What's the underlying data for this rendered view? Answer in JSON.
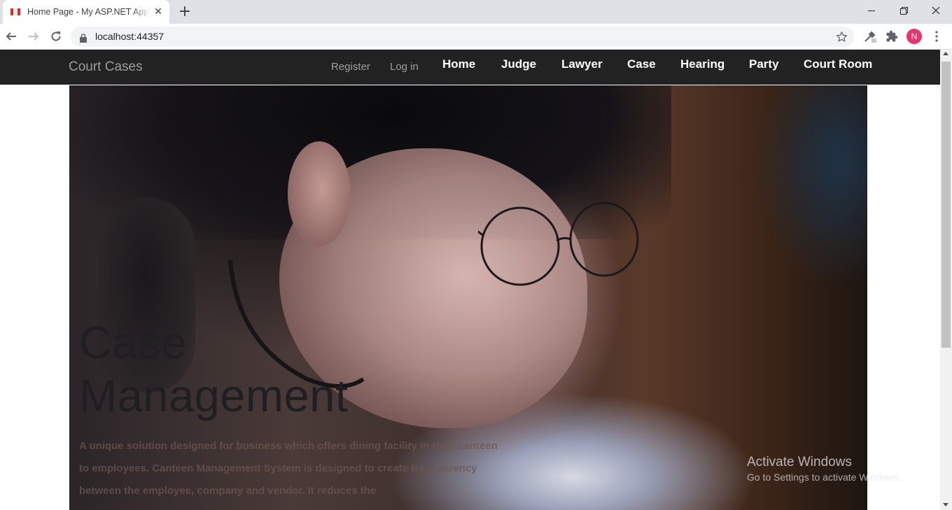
{
  "browser": {
    "tab_title": "Home Page - My ASP.NET Application",
    "tab_close": "✕",
    "new_tab": "+",
    "url": "localhost:44357",
    "profile_initial": "N",
    "favicon_colors": [
      "#d93025",
      "#ffffff",
      "#1a73e8"
    ]
  },
  "site": {
    "brand": "Court Cases",
    "auth_links": {
      "register": "Register",
      "login": "Log in"
    },
    "nav": [
      {
        "label": "Home"
      },
      {
        "label": "Judge"
      },
      {
        "label": "Lawyer"
      },
      {
        "label": "Case"
      },
      {
        "label": "Hearing"
      },
      {
        "label": "Party"
      },
      {
        "label": "Court Room"
      }
    ]
  },
  "hero": {
    "title_line1": "Case",
    "title_line2": "Management",
    "text": "A unique solution designed for business which offers dining facility in their canteen to employees. Canteen Management System is designed to create transparency between the employee, company and vendor. It reduces the"
  },
  "os_watermark": {
    "line1": "Activate Windows",
    "line2": "Go to Settings to activate Windows."
  },
  "colors": {
    "navbar_bg": "#222222",
    "brand_color": "#9d9d9d",
    "nav_link_color": "#ffffff",
    "avatar_bg": "#e8336b"
  }
}
